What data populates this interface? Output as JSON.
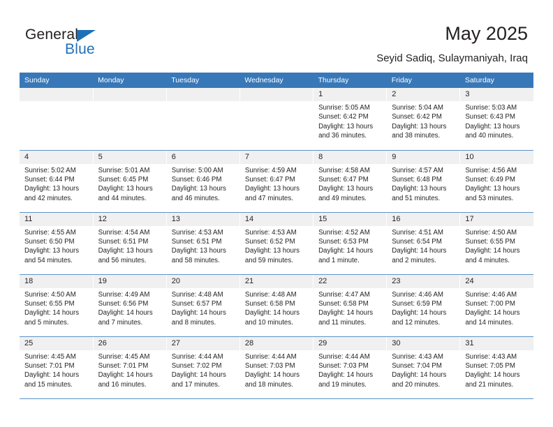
{
  "brand": {
    "name_part1": "General",
    "name_part2": "Blue",
    "accent_color": "#1d70b8"
  },
  "header": {
    "title": "May 2025",
    "subtitle": "Seyid Sadiq, Sulaymaniyah, Iraq"
  },
  "theme": {
    "header_row_bg": "#3878b8",
    "daynum_bg": "#f0f0f0",
    "row_divider": "#5c93c8",
    "text": "#231f20"
  },
  "columns": [
    "Sunday",
    "Monday",
    "Tuesday",
    "Wednesday",
    "Thursday",
    "Friday",
    "Saturday"
  ],
  "weeks": [
    [
      {
        "day": "",
        "lines": []
      },
      {
        "day": "",
        "lines": []
      },
      {
        "day": "",
        "lines": []
      },
      {
        "day": "",
        "lines": []
      },
      {
        "day": "1",
        "lines": [
          "Sunrise: 5:05 AM",
          "Sunset: 6:42 PM",
          "Daylight: 13 hours",
          "and 36 minutes."
        ]
      },
      {
        "day": "2",
        "lines": [
          "Sunrise: 5:04 AM",
          "Sunset: 6:42 PM",
          "Daylight: 13 hours",
          "and 38 minutes."
        ]
      },
      {
        "day": "3",
        "lines": [
          "Sunrise: 5:03 AM",
          "Sunset: 6:43 PM",
          "Daylight: 13 hours",
          "and 40 minutes."
        ]
      }
    ],
    [
      {
        "day": "4",
        "lines": [
          "Sunrise: 5:02 AM",
          "Sunset: 6:44 PM",
          "Daylight: 13 hours",
          "and 42 minutes."
        ]
      },
      {
        "day": "5",
        "lines": [
          "Sunrise: 5:01 AM",
          "Sunset: 6:45 PM",
          "Daylight: 13 hours",
          "and 44 minutes."
        ]
      },
      {
        "day": "6",
        "lines": [
          "Sunrise: 5:00 AM",
          "Sunset: 6:46 PM",
          "Daylight: 13 hours",
          "and 46 minutes."
        ]
      },
      {
        "day": "7",
        "lines": [
          "Sunrise: 4:59 AM",
          "Sunset: 6:47 PM",
          "Daylight: 13 hours",
          "and 47 minutes."
        ]
      },
      {
        "day": "8",
        "lines": [
          "Sunrise: 4:58 AM",
          "Sunset: 6:47 PM",
          "Daylight: 13 hours",
          "and 49 minutes."
        ]
      },
      {
        "day": "9",
        "lines": [
          "Sunrise: 4:57 AM",
          "Sunset: 6:48 PM",
          "Daylight: 13 hours",
          "and 51 minutes."
        ]
      },
      {
        "day": "10",
        "lines": [
          "Sunrise: 4:56 AM",
          "Sunset: 6:49 PM",
          "Daylight: 13 hours",
          "and 53 minutes."
        ]
      }
    ],
    [
      {
        "day": "11",
        "lines": [
          "Sunrise: 4:55 AM",
          "Sunset: 6:50 PM",
          "Daylight: 13 hours",
          "and 54 minutes."
        ]
      },
      {
        "day": "12",
        "lines": [
          "Sunrise: 4:54 AM",
          "Sunset: 6:51 PM",
          "Daylight: 13 hours",
          "and 56 minutes."
        ]
      },
      {
        "day": "13",
        "lines": [
          "Sunrise: 4:53 AM",
          "Sunset: 6:51 PM",
          "Daylight: 13 hours",
          "and 58 minutes."
        ]
      },
      {
        "day": "14",
        "lines": [
          "Sunrise: 4:53 AM",
          "Sunset: 6:52 PM",
          "Daylight: 13 hours",
          "and 59 minutes."
        ]
      },
      {
        "day": "15",
        "lines": [
          "Sunrise: 4:52 AM",
          "Sunset: 6:53 PM",
          "Daylight: 14 hours",
          "and 1 minute."
        ]
      },
      {
        "day": "16",
        "lines": [
          "Sunrise: 4:51 AM",
          "Sunset: 6:54 PM",
          "Daylight: 14 hours",
          "and 2 minutes."
        ]
      },
      {
        "day": "17",
        "lines": [
          "Sunrise: 4:50 AM",
          "Sunset: 6:55 PM",
          "Daylight: 14 hours",
          "and 4 minutes."
        ]
      }
    ],
    [
      {
        "day": "18",
        "lines": [
          "Sunrise: 4:50 AM",
          "Sunset: 6:55 PM",
          "Daylight: 14 hours",
          "and 5 minutes."
        ]
      },
      {
        "day": "19",
        "lines": [
          "Sunrise: 4:49 AM",
          "Sunset: 6:56 PM",
          "Daylight: 14 hours",
          "and 7 minutes."
        ]
      },
      {
        "day": "20",
        "lines": [
          "Sunrise: 4:48 AM",
          "Sunset: 6:57 PM",
          "Daylight: 14 hours",
          "and 8 minutes."
        ]
      },
      {
        "day": "21",
        "lines": [
          "Sunrise: 4:48 AM",
          "Sunset: 6:58 PM",
          "Daylight: 14 hours",
          "and 10 minutes."
        ]
      },
      {
        "day": "22",
        "lines": [
          "Sunrise: 4:47 AM",
          "Sunset: 6:58 PM",
          "Daylight: 14 hours",
          "and 11 minutes."
        ]
      },
      {
        "day": "23",
        "lines": [
          "Sunrise: 4:46 AM",
          "Sunset: 6:59 PM",
          "Daylight: 14 hours",
          "and 12 minutes."
        ]
      },
      {
        "day": "24",
        "lines": [
          "Sunrise: 4:46 AM",
          "Sunset: 7:00 PM",
          "Daylight: 14 hours",
          "and 14 minutes."
        ]
      }
    ],
    [
      {
        "day": "25",
        "lines": [
          "Sunrise: 4:45 AM",
          "Sunset: 7:01 PM",
          "Daylight: 14 hours",
          "and 15 minutes."
        ]
      },
      {
        "day": "26",
        "lines": [
          "Sunrise: 4:45 AM",
          "Sunset: 7:01 PM",
          "Daylight: 14 hours",
          "and 16 minutes."
        ]
      },
      {
        "day": "27",
        "lines": [
          "Sunrise: 4:44 AM",
          "Sunset: 7:02 PM",
          "Daylight: 14 hours",
          "and 17 minutes."
        ]
      },
      {
        "day": "28",
        "lines": [
          "Sunrise: 4:44 AM",
          "Sunset: 7:03 PM",
          "Daylight: 14 hours",
          "and 18 minutes."
        ]
      },
      {
        "day": "29",
        "lines": [
          "Sunrise: 4:44 AM",
          "Sunset: 7:03 PM",
          "Daylight: 14 hours",
          "and 19 minutes."
        ]
      },
      {
        "day": "30",
        "lines": [
          "Sunrise: 4:43 AM",
          "Sunset: 7:04 PM",
          "Daylight: 14 hours",
          "and 20 minutes."
        ]
      },
      {
        "day": "31",
        "lines": [
          "Sunrise: 4:43 AM",
          "Sunset: 7:05 PM",
          "Daylight: 14 hours",
          "and 21 minutes."
        ]
      }
    ]
  ]
}
